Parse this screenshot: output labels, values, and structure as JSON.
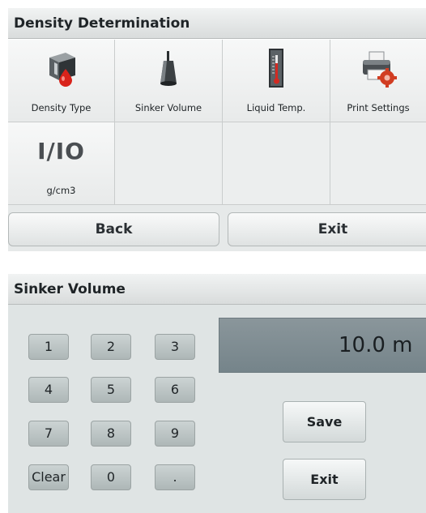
{
  "density_screen": {
    "title": "Density Determination",
    "tiles": [
      {
        "label": "Density Type",
        "icon": "density-type-icon"
      },
      {
        "label": "Sinker Volume",
        "icon": "sinker-icon"
      },
      {
        "label": "Liquid Temp.",
        "icon": "thermometer-icon"
      },
      {
        "label": "Print Settings",
        "icon": "printer-settings-icon"
      },
      {
        "label": "g/cm3",
        "icon_text": "I/IO"
      }
    ],
    "back_label": "Back",
    "exit_label": "Exit"
  },
  "sinker_screen": {
    "title": "Sinker Volume",
    "display_value": "10.0 m",
    "keys": [
      "1",
      "2",
      "3",
      "4",
      "5",
      "6",
      "7",
      "8",
      "9",
      "Clear",
      "0",
      "."
    ],
    "save_label": "Save",
    "exit_label": "Exit"
  },
  "colors": {
    "title_bg": "#dfe2e2",
    "display_bg": "#7f8d92",
    "key_bg": "#bcc4c4"
  }
}
